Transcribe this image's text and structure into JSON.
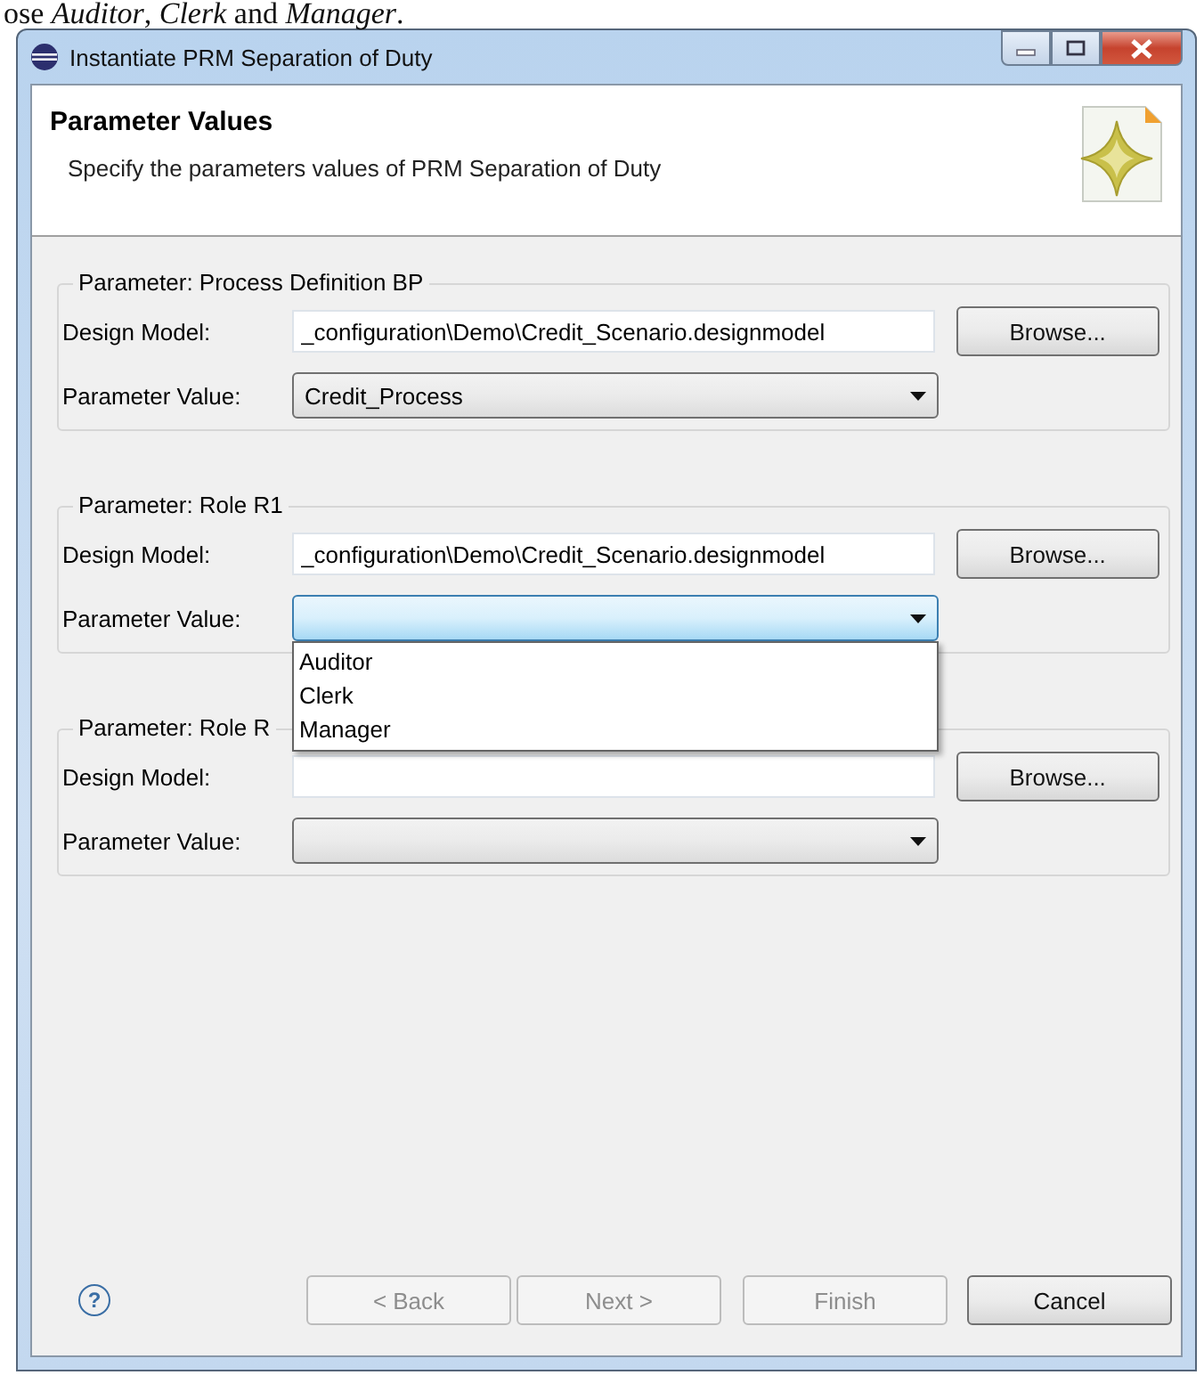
{
  "page_text": "ose *Auditor*, *Clerk* and *Manager*.",
  "window": {
    "title": "Instantiate PRM Separation of Duty"
  },
  "header": {
    "title": "Parameter Values",
    "description": "Specify the parameters values of PRM Separation of Duty"
  },
  "groups": [
    {
      "legend": "Parameter: Process Definition BP",
      "design_model_label": "Design Model:",
      "design_model": "_configuration\\Demo\\Credit_Scenario.designmodel",
      "browse": "Browse...",
      "value_label": "Parameter Value:",
      "value": "Credit_Process",
      "expanded": false
    },
    {
      "legend": "Parameter: Role R1",
      "design_model_label": "Design Model:",
      "design_model": "_configuration\\Demo\\Credit_Scenario.designmodel",
      "browse": "Browse...",
      "value_label": "Parameter Value:",
      "expanded": true,
      "options": [
        {
          "label": "Auditor"
        },
        {
          "label": "Clerk"
        },
        {
          "label": "Manager"
        }
      ]
    },
    {
      "legend": "Parameter: Role R",
      "design_model_label": "Design Model:",
      "browse": "Browse...",
      "value_label": "Parameter Value:",
      "expanded": false
    }
  ],
  "help": {
    "symbol": "?"
  },
  "buttons": [
    {
      "label": "< Back",
      "disabled": true
    },
    {
      "label": "Next >",
      "disabled": true
    },
    {
      "label": "Finish",
      "disabled": true
    },
    {
      "label": "Cancel",
      "disabled": false
    }
  ]
}
